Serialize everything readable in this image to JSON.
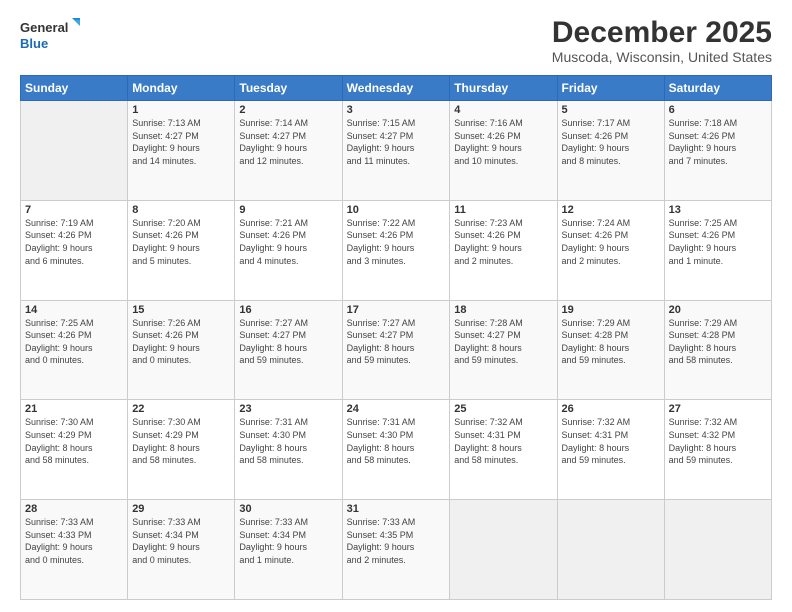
{
  "logo": {
    "line1": "General",
    "line2": "Blue"
  },
  "title": "December 2025",
  "location": "Muscoda, Wisconsin, United States",
  "days_header": [
    "Sunday",
    "Monday",
    "Tuesday",
    "Wednesday",
    "Thursday",
    "Friday",
    "Saturday"
  ],
  "weeks": [
    [
      {
        "day": "",
        "info": ""
      },
      {
        "day": "1",
        "info": "Sunrise: 7:13 AM\nSunset: 4:27 PM\nDaylight: 9 hours\nand 14 minutes."
      },
      {
        "day": "2",
        "info": "Sunrise: 7:14 AM\nSunset: 4:27 PM\nDaylight: 9 hours\nand 12 minutes."
      },
      {
        "day": "3",
        "info": "Sunrise: 7:15 AM\nSunset: 4:27 PM\nDaylight: 9 hours\nand 11 minutes."
      },
      {
        "day": "4",
        "info": "Sunrise: 7:16 AM\nSunset: 4:26 PM\nDaylight: 9 hours\nand 10 minutes."
      },
      {
        "day": "5",
        "info": "Sunrise: 7:17 AM\nSunset: 4:26 PM\nDaylight: 9 hours\nand 8 minutes."
      },
      {
        "day": "6",
        "info": "Sunrise: 7:18 AM\nSunset: 4:26 PM\nDaylight: 9 hours\nand 7 minutes."
      }
    ],
    [
      {
        "day": "7",
        "info": "Sunrise: 7:19 AM\nSunset: 4:26 PM\nDaylight: 9 hours\nand 6 minutes."
      },
      {
        "day": "8",
        "info": "Sunrise: 7:20 AM\nSunset: 4:26 PM\nDaylight: 9 hours\nand 5 minutes."
      },
      {
        "day": "9",
        "info": "Sunrise: 7:21 AM\nSunset: 4:26 PM\nDaylight: 9 hours\nand 4 minutes."
      },
      {
        "day": "10",
        "info": "Sunrise: 7:22 AM\nSunset: 4:26 PM\nDaylight: 9 hours\nand 3 minutes."
      },
      {
        "day": "11",
        "info": "Sunrise: 7:23 AM\nSunset: 4:26 PM\nDaylight: 9 hours\nand 2 minutes."
      },
      {
        "day": "12",
        "info": "Sunrise: 7:24 AM\nSunset: 4:26 PM\nDaylight: 9 hours\nand 2 minutes."
      },
      {
        "day": "13",
        "info": "Sunrise: 7:25 AM\nSunset: 4:26 PM\nDaylight: 9 hours\nand 1 minute."
      }
    ],
    [
      {
        "day": "14",
        "info": "Sunrise: 7:25 AM\nSunset: 4:26 PM\nDaylight: 9 hours\nand 0 minutes."
      },
      {
        "day": "15",
        "info": "Sunrise: 7:26 AM\nSunset: 4:26 PM\nDaylight: 9 hours\nand 0 minutes."
      },
      {
        "day": "16",
        "info": "Sunrise: 7:27 AM\nSunset: 4:27 PM\nDaylight: 8 hours\nand 59 minutes."
      },
      {
        "day": "17",
        "info": "Sunrise: 7:27 AM\nSunset: 4:27 PM\nDaylight: 8 hours\nand 59 minutes."
      },
      {
        "day": "18",
        "info": "Sunrise: 7:28 AM\nSunset: 4:27 PM\nDaylight: 8 hours\nand 59 minutes."
      },
      {
        "day": "19",
        "info": "Sunrise: 7:29 AM\nSunset: 4:28 PM\nDaylight: 8 hours\nand 59 minutes."
      },
      {
        "day": "20",
        "info": "Sunrise: 7:29 AM\nSunset: 4:28 PM\nDaylight: 8 hours\nand 58 minutes."
      }
    ],
    [
      {
        "day": "21",
        "info": "Sunrise: 7:30 AM\nSunset: 4:29 PM\nDaylight: 8 hours\nand 58 minutes."
      },
      {
        "day": "22",
        "info": "Sunrise: 7:30 AM\nSunset: 4:29 PM\nDaylight: 8 hours\nand 58 minutes."
      },
      {
        "day": "23",
        "info": "Sunrise: 7:31 AM\nSunset: 4:30 PM\nDaylight: 8 hours\nand 58 minutes."
      },
      {
        "day": "24",
        "info": "Sunrise: 7:31 AM\nSunset: 4:30 PM\nDaylight: 8 hours\nand 58 minutes."
      },
      {
        "day": "25",
        "info": "Sunrise: 7:32 AM\nSunset: 4:31 PM\nDaylight: 8 hours\nand 58 minutes."
      },
      {
        "day": "26",
        "info": "Sunrise: 7:32 AM\nSunset: 4:31 PM\nDaylight: 8 hours\nand 59 minutes."
      },
      {
        "day": "27",
        "info": "Sunrise: 7:32 AM\nSunset: 4:32 PM\nDaylight: 8 hours\nand 59 minutes."
      }
    ],
    [
      {
        "day": "28",
        "info": "Sunrise: 7:33 AM\nSunset: 4:33 PM\nDaylight: 9 hours\nand 0 minutes."
      },
      {
        "day": "29",
        "info": "Sunrise: 7:33 AM\nSunset: 4:34 PM\nDaylight: 9 hours\nand 0 minutes."
      },
      {
        "day": "30",
        "info": "Sunrise: 7:33 AM\nSunset: 4:34 PM\nDaylight: 9 hours\nand 1 minute."
      },
      {
        "day": "31",
        "info": "Sunrise: 7:33 AM\nSunset: 4:35 PM\nDaylight: 9 hours\nand 2 minutes."
      },
      {
        "day": "",
        "info": ""
      },
      {
        "day": "",
        "info": ""
      },
      {
        "day": "",
        "info": ""
      }
    ]
  ]
}
